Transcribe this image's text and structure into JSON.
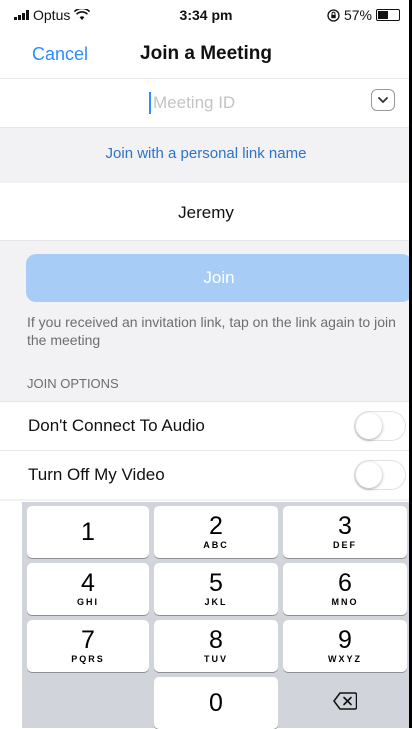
{
  "status_bar": {
    "carrier": "Optus",
    "time": "3:34 pm",
    "battery_text": "57%",
    "battery_level": 0.57
  },
  "nav": {
    "cancel_label": "Cancel",
    "title": "Join a Meeting"
  },
  "meeting_id": {
    "placeholder": "Meeting ID"
  },
  "personal_link": "Join with a personal link name",
  "screen_name": "Jeremy",
  "join_button": "Join",
  "help_text": "If you received an invitation link, tap on the link again to join the meeting",
  "join_options": {
    "header": "JOIN OPTIONS",
    "items": [
      {
        "label": "Don't Connect To Audio",
        "enabled": false
      },
      {
        "label": "Turn Off My Video",
        "enabled": false
      }
    ]
  },
  "keypad": {
    "keys": [
      {
        "num": "1",
        "letters": ""
      },
      {
        "num": "2",
        "letters": "ABC"
      },
      {
        "num": "3",
        "letters": "DEF"
      },
      {
        "num": "4",
        "letters": "GHI"
      },
      {
        "num": "5",
        "letters": "JKL"
      },
      {
        "num": "6",
        "letters": "MNO"
      },
      {
        "num": "7",
        "letters": "PQRS"
      },
      {
        "num": "8",
        "letters": "TUV"
      },
      {
        "num": "9",
        "letters": "WXYZ"
      },
      {
        "num": "0",
        "letters": ""
      }
    ]
  },
  "colors": {
    "accent": "#2d8cff",
    "join_disabled": "#a7cdf6",
    "group_background": "#f2f2f4"
  }
}
